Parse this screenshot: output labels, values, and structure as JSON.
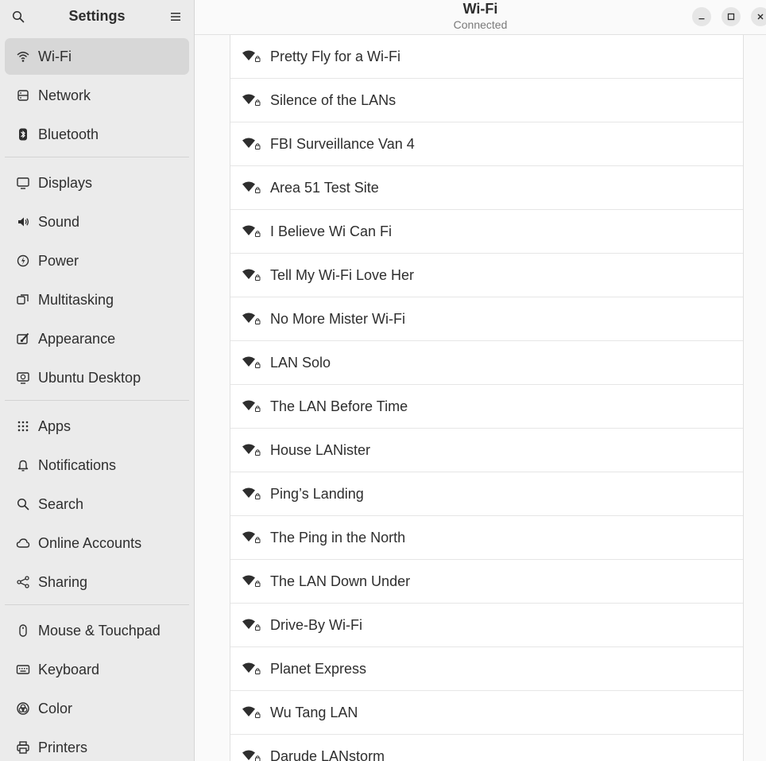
{
  "sidebar": {
    "title": "Settings",
    "groups": [
      [
        {
          "label": "Wi-Fi",
          "icon": "wifi-icon",
          "active": true
        },
        {
          "label": "Network",
          "icon": "network-icon"
        },
        {
          "label": "Bluetooth",
          "icon": "bluetooth-icon"
        }
      ],
      [
        {
          "label": "Displays",
          "icon": "display-icon"
        },
        {
          "label": "Sound",
          "icon": "sound-icon"
        },
        {
          "label": "Power",
          "icon": "power-icon"
        },
        {
          "label": "Multitasking",
          "icon": "multitasking-icon"
        },
        {
          "label": "Appearance",
          "icon": "appearance-icon"
        },
        {
          "label": "Ubuntu Desktop",
          "icon": "ubuntu-desktop-icon"
        }
      ],
      [
        {
          "label": "Apps",
          "icon": "apps-icon"
        },
        {
          "label": "Notifications",
          "icon": "bell-icon"
        },
        {
          "label": "Search",
          "icon": "search-icon"
        },
        {
          "label": "Online Accounts",
          "icon": "cloud-icon"
        },
        {
          "label": "Sharing",
          "icon": "share-icon"
        }
      ],
      [
        {
          "label": "Mouse & Touchpad",
          "icon": "mouse-icon"
        },
        {
          "label": "Keyboard",
          "icon": "keyboard-icon"
        },
        {
          "label": "Color",
          "icon": "color-icon"
        },
        {
          "label": "Printers",
          "icon": "printer-icon"
        }
      ]
    ]
  },
  "header": {
    "title": "Wi-Fi",
    "subtitle": "Connected"
  },
  "networks": [
    "Pretty Fly for a Wi-Fi",
    "Silence of the LANs",
    "FBI Surveillance Van 4",
    "Area 51 Test Site",
    "I Believe Wi Can Fi",
    "Tell My Wi-Fi Love Her",
    "No More Mister Wi-Fi",
    "LAN Solo",
    "The LAN Before Time",
    "House LANister",
    "Ping’s Landing",
    "The Ping in the North",
    "The LAN Down Under",
    "Drive-By Wi-Fi",
    "Planet Express",
    "Wu Tang LAN",
    "Darude LANstorm"
  ],
  "colors": {
    "sidebar_bg": "#ebebeb",
    "active_bg": "#d7d7d7",
    "text": "#2e2e2e"
  }
}
